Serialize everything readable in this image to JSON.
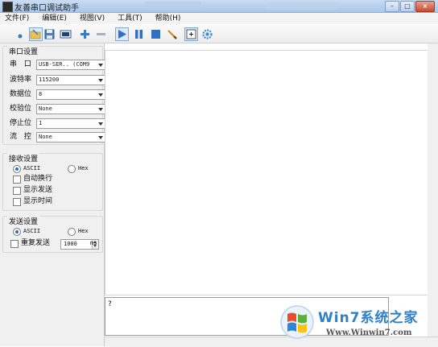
{
  "window": {
    "title": "友善串口调试助手"
  },
  "menu": [
    "文件(F)",
    "编辑(E)",
    "视图(V)",
    "工具(T)",
    "帮助(H)"
  ],
  "toolbar": {
    "icons": [
      "new-icon",
      "open-folder-icon",
      "save-icon",
      "com-port-icon",
      "add-icon",
      "remove-icon",
      "play-icon",
      "pause-icon",
      "stop-icon",
      "clear-brush-icon",
      "add-window-icon",
      "settings-gear-icon"
    ]
  },
  "serial_settings": {
    "title": "串口设置",
    "fields": [
      {
        "label": "串 口",
        "value": "USB-SER.. (COM9"
      },
      {
        "label": "波特率",
        "value": "115200"
      },
      {
        "label": "数据位",
        "value": "8"
      },
      {
        "label": "校验位",
        "value": "None"
      },
      {
        "label": "停止位",
        "value": "1"
      },
      {
        "label": "流 控",
        "value": "None"
      }
    ]
  },
  "receive_settings": {
    "title": "接收设置",
    "mode": {
      "ascii": "ASCII",
      "hex": "Hex",
      "selected": "ASCII"
    },
    "options": [
      {
        "label": "自动换行",
        "checked": false
      },
      {
        "label": "显示发送",
        "checked": false
      },
      {
        "label": "显示时间",
        "checked": false
      }
    ]
  },
  "send_settings": {
    "title": "发送设置",
    "mode": {
      "ascii": "ASCII",
      "hex": "Hex",
      "selected": "ASCII"
    },
    "repeat": {
      "label": "重复发送",
      "checked": false,
      "interval": "1000",
      "unit": "ms"
    }
  },
  "send_area": {
    "text": "?"
  },
  "watermark": {
    "title": "Win7系统之家",
    "url": "Www.Winwin7.com"
  }
}
